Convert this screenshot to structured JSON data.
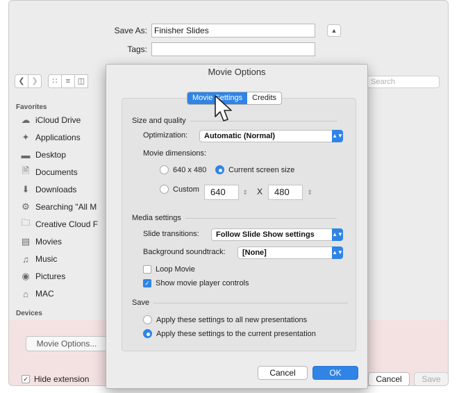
{
  "save_dialog": {
    "save_as_label": "Save As:",
    "save_as_value": "Finisher Slides",
    "tags_label": "Tags:",
    "tags_value": "",
    "search_placeholder": "Search",
    "sidebar": {
      "favorites_header": "Favorites",
      "items": [
        {
          "label": "iCloud Drive",
          "icon": "cloud-icon"
        },
        {
          "label": "Applications",
          "icon": "applications-icon"
        },
        {
          "label": "Desktop",
          "icon": "desktop-icon"
        },
        {
          "label": "Documents",
          "icon": "documents-icon"
        },
        {
          "label": "Downloads",
          "icon": "downloads-icon"
        },
        {
          "label": "Searching \"All M",
          "icon": "gear-icon"
        },
        {
          "label": "Creative Cloud F",
          "icon": "folder-icon"
        },
        {
          "label": "Movies",
          "icon": "movies-icon"
        },
        {
          "label": "Music",
          "icon": "music-icon"
        },
        {
          "label": "Pictures",
          "icon": "camera-icon"
        },
        {
          "label": "MAC",
          "icon": "home-icon"
        }
      ],
      "devices_header": "Devices"
    },
    "movie_options_button": "Movie Options...",
    "hide_extension_label": "Hide extension",
    "hide_extension_checked": true,
    "cancel_label": "Cancel",
    "save_label": "Save"
  },
  "movie_options": {
    "title": "Movie Options",
    "tabs": [
      {
        "label": "Movie Settings",
        "active": true
      },
      {
        "label": "Credits",
        "active": false
      }
    ],
    "size_quality": {
      "header": "Size and quality",
      "optimization_label": "Optimization:",
      "optimization_value": "Automatic (Normal)",
      "dimensions_label": "Movie dimensions:",
      "option_640": "640 x 480",
      "option_current": "Current screen size",
      "option_custom": "Custom",
      "custom_width": "640",
      "custom_x": "X",
      "custom_height": "480"
    },
    "media": {
      "header": "Media settings",
      "transitions_label": "Slide transitions:",
      "transitions_value": "Follow Slide Show settings",
      "soundtrack_label": "Background soundtrack:",
      "soundtrack_value": "[None]",
      "loop_label": "Loop Movie",
      "loop_checked": false,
      "controls_label": "Show movie player controls",
      "controls_checked": true
    },
    "save_section": {
      "header": "Save",
      "option_all": "Apply these settings to all new presentations",
      "option_current": "Apply these settings to the current presentation"
    },
    "cancel_label": "Cancel",
    "ok_label": "OK"
  },
  "colors": {
    "accent": "#2f84e6",
    "dialog_bg": "#ececec",
    "bottom_band": "#f4e2e2"
  }
}
